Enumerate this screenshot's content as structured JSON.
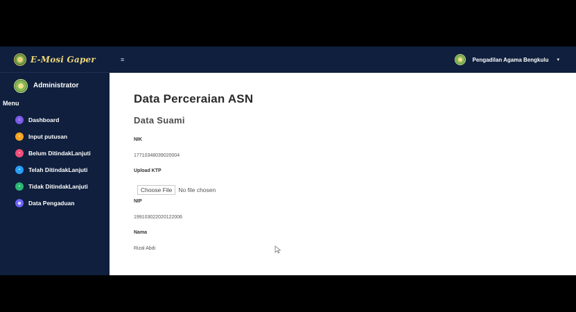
{
  "brand": {
    "title": "E-Mosi Gaper"
  },
  "user": {
    "name": "Administrator"
  },
  "sidebar": {
    "menu_title": "Menu",
    "items": [
      {
        "label": "Dashboard",
        "icon": "home-icon",
        "color": "#7a5ae6",
        "glyph": "⌂"
      },
      {
        "label": "Input putusan",
        "icon": "document-icon",
        "color": "#f5a524",
        "glyph": "▪"
      },
      {
        "label": "Belum DitindakLanjuti",
        "icon": "alert-icon",
        "color": "#ef4f7a",
        "glyph": "▪"
      },
      {
        "label": "Telah DitindakLanjuti",
        "icon": "check-icon",
        "color": "#2a9df4",
        "glyph": "▪"
      },
      {
        "label": "Tidak DitindakLanjuti",
        "icon": "cancel-icon",
        "color": "#2bb673",
        "glyph": "▪"
      },
      {
        "label": "Data Pengaduan",
        "icon": "complaint-icon",
        "color": "#6c63ff",
        "glyph": "⊕"
      }
    ]
  },
  "topbar": {
    "menu_toggle": "≡",
    "court_name": "Pengadilan Agama Bengkulu",
    "caret": "▾"
  },
  "page": {
    "title": "Data Perceraian ASN",
    "section": "Data Suami",
    "fields": {
      "nik_label": "NIK",
      "nik_value": "1771034803902000​4",
      "ktp_label": "Upload KTP",
      "file_button": "Choose File",
      "file_status": "No file chosen",
      "nip_label": "NIP",
      "nip_value": "199103022020122006",
      "nama_label": "Nama",
      "nama_value": "Rizal Abdi"
    }
  }
}
